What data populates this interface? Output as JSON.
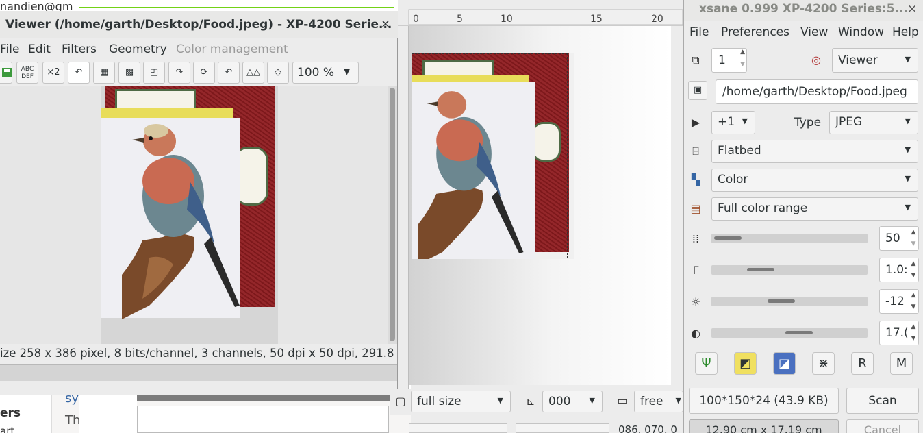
{
  "background": {
    "email_fragment": "nandien@gm",
    "sidebar_label": "ers",
    "sidebar_label2": "art",
    "link_fragment": "sy",
    "text_fragment": "Th"
  },
  "viewer": {
    "title": "Viewer (/home/garth/Desktop/Food.jpeg) - XP-4200 Serie...",
    "close_glyph": "×",
    "menu": [
      "File",
      "Edit",
      "Filters",
      "Geometry",
      "Color management"
    ],
    "toolbar": {
      "save_icon": "save-icon",
      "ocr_label": "ABC DEF",
      "scale_label": "×2",
      "undo_icon": "undo-icon",
      "zoom": "100 %"
    },
    "status": "ize 258 x 386 pixel, 8 bits/channel, 3 channels, 50 dpi x 50 dpi, 291.8 KB",
    "colors": {
      "card_red": "#8e1b1f",
      "card_green": "#4f6a45",
      "yellow": "#e8dd5a"
    }
  },
  "preview": {
    "preset": "full size",
    "rotation": "000",
    "aspect": "free",
    "coords": "086, 070, 0"
  },
  "xsane": {
    "title": "xsane 0.999 XP-4200 Series:5...",
    "close_glyph": "×",
    "menu": [
      "File",
      "Preferences",
      "View",
      "Window",
      "Help"
    ],
    "copies": "1",
    "target": "Viewer",
    "filename": "/home/garth/Desktop/Food.jpeg",
    "counter": "+1",
    "type_label": "Type",
    "type_value": "JPEG",
    "source": "Flatbed",
    "mode": "Color",
    "color_range": "Full color range",
    "resolution": "50",
    "gamma": "1.0:",
    "brightness": "-12",
    "contrast": "17.(",
    "size_info": "100*150*24 (43.9 KB)",
    "scan_label": "Scan",
    "dimensions": "12.90 cm x 17.19 cm",
    "cancel_label": "Cancel"
  }
}
